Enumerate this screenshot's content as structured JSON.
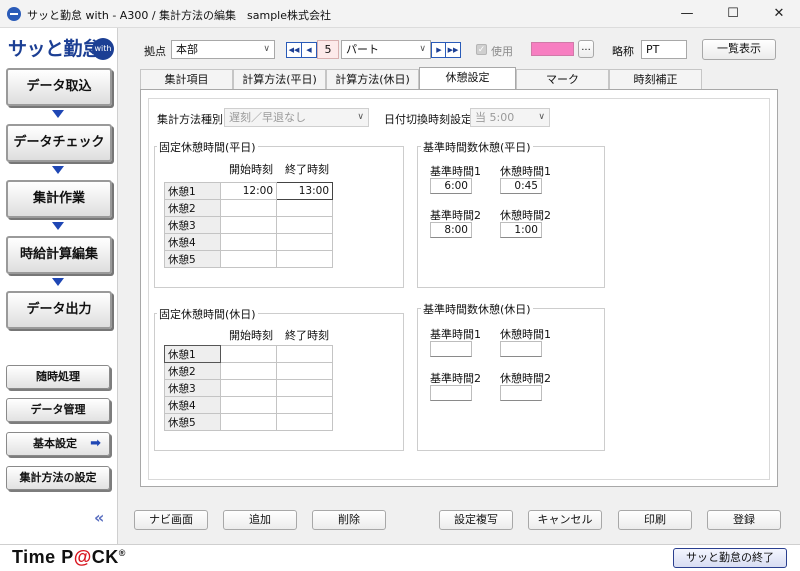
{
  "window": {
    "title": "サッと勤怠 with - A300 / 集計方法の編集　sample株式会社",
    "minimize": "—",
    "maximize": "☐",
    "close": "✕"
  },
  "logo": {
    "text": "サッと勤怠",
    "badge": "with"
  },
  "nav": {
    "steps": [
      "データ取込",
      "データチェック",
      "集計作業",
      "時給計算編集",
      "データ出力"
    ],
    "side_buttons": [
      "随時処理",
      "データ管理",
      "基本設定",
      "集計方法の設定"
    ],
    "collapse": "«"
  },
  "toolbar": {
    "site_label": "拠点",
    "site_value": "本部",
    "record_number": "5",
    "type_value": "パート",
    "use_label": "使用",
    "color_more": "...",
    "abbr_label": "略称",
    "abbr_value": "PT",
    "list_button": "一覧表示",
    "color_swatch": "#f77ec1"
  },
  "tabs": [
    "集計項目",
    "計算方法(平日)",
    "計算方法(休日)",
    "休憩設定",
    "マーク",
    "時刻補正"
  ],
  "active_tab": "休憩設定",
  "settings": {
    "method_label": "集計方法種別",
    "method_value": "遅刻／早退なし",
    "date_switch_label": "日付切換時刻設定",
    "date_switch_value": "当 5:00"
  },
  "fixed_weekday": {
    "title": "固定休憩時間(平日)",
    "col_start": "開始時刻",
    "col_end": "終了時刻",
    "rows": [
      {
        "label": "休憩1",
        "start": "12:00",
        "end": "13:00"
      },
      {
        "label": "休憩2",
        "start": "",
        "end": ""
      },
      {
        "label": "休憩3",
        "start": "",
        "end": ""
      },
      {
        "label": "休憩4",
        "start": "",
        "end": ""
      },
      {
        "label": "休憩5",
        "start": "",
        "end": ""
      }
    ]
  },
  "fixed_holiday": {
    "title": "固定休憩時間(休日)",
    "col_start": "開始時刻",
    "col_end": "終了時刻",
    "rows": [
      {
        "label": "休憩1",
        "start": "",
        "end": ""
      },
      {
        "label": "休憩2",
        "start": "",
        "end": ""
      },
      {
        "label": "休憩3",
        "start": "",
        "end": ""
      },
      {
        "label": "休憩4",
        "start": "",
        "end": ""
      },
      {
        "label": "休憩5",
        "start": "",
        "end": ""
      }
    ]
  },
  "std_weekday": {
    "title": "基準時間数休憩(平日)",
    "items": [
      {
        "std_label": "基準時間1",
        "std_value": "6:00",
        "break_label": "休憩時間1",
        "break_value": "0:45"
      },
      {
        "std_label": "基準時間2",
        "std_value": "8:00",
        "break_label": "休憩時間2",
        "break_value": "1:00"
      }
    ]
  },
  "std_holiday": {
    "title": "基準時間数休憩(休日)",
    "items": [
      {
        "std_label": "基準時間1",
        "std_value": "",
        "break_label": "休憩時間1",
        "break_value": ""
      },
      {
        "std_label": "基準時間2",
        "std_value": "",
        "break_label": "休憩時間2",
        "break_value": ""
      }
    ]
  },
  "bottom_buttons": [
    "ナビ画面",
    "追加",
    "削除",
    "設定複写",
    "キャンセル",
    "印刷",
    "登録"
  ],
  "footer": {
    "brand_a": "Time P",
    "brand_at": "@",
    "brand_b": "CK",
    "brand_reg": "®",
    "exit_button": "サッと勤怠の終了"
  }
}
